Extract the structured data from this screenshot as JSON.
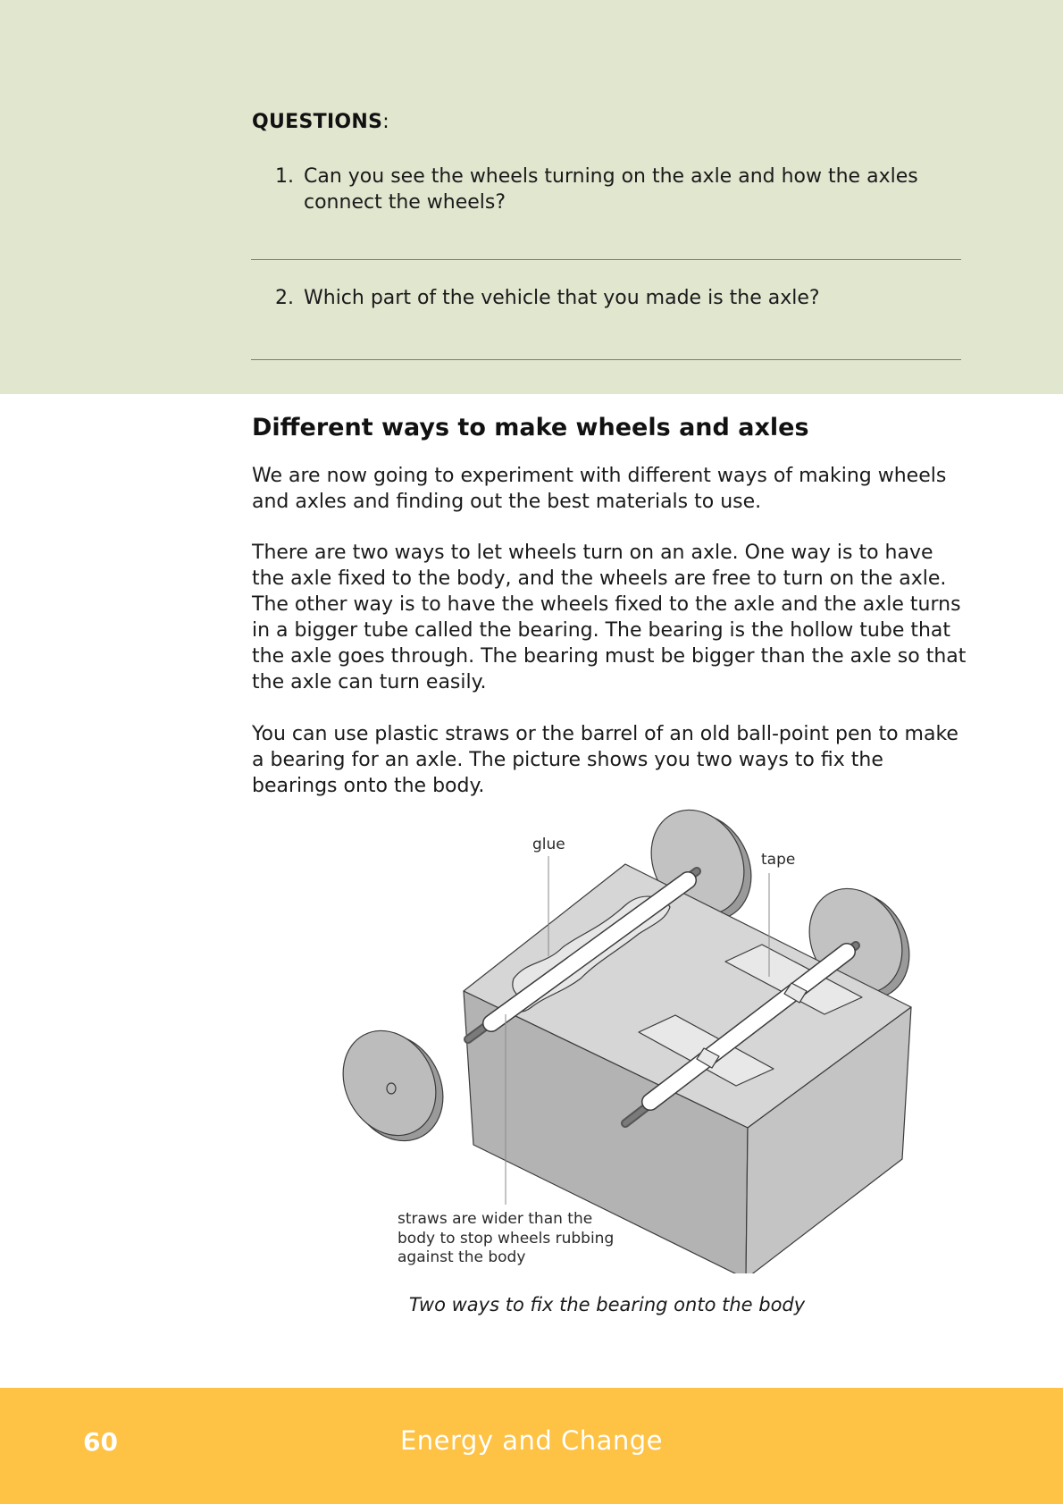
{
  "questions": {
    "heading": "QUESTIONS",
    "heading_suffix": ":",
    "items": [
      {
        "number": "1.",
        "text": "Can you see the wheels turning on the axle and how the axles connect the wheels?"
      },
      {
        "number": "2.",
        "text": "Which part of the vehicle that you made is the axle?"
      }
    ]
  },
  "section": {
    "title": "Different ways to make wheels and axles",
    "paragraphs": [
      "We are now going to experiment with different ways of making wheels and axles and finding out the best materials to use.",
      "There are two ways to let wheels turn on an axle. One way is to have the axle fixed to the body, and the wheels are free to turn on the axle. The other way is to have the wheels fixed to the axle and the axle turns in a bigger tube called the bearing. The bearing is the hollow tube that the axle goes through. The bearing must be bigger than the axle so that the axle can turn easily.",
      "You can use plastic straws or the barrel of an old ball-point pen to make a bearing for an axle. The picture shows you two ways to fix the bearings onto the body."
    ]
  },
  "figure": {
    "labels": {
      "glue": "glue",
      "tape": "tape",
      "straws": [
        "straws are wider than the",
        "body to stop wheels rubbing",
        "against the body"
      ]
    },
    "caption": "Two ways to fix the bearing onto the body"
  },
  "footer": {
    "page_number": "60",
    "book_title": "Energy and Change"
  },
  "colors": {
    "questions_background": "#e1e6cf",
    "footer_background": "#fec244"
  }
}
